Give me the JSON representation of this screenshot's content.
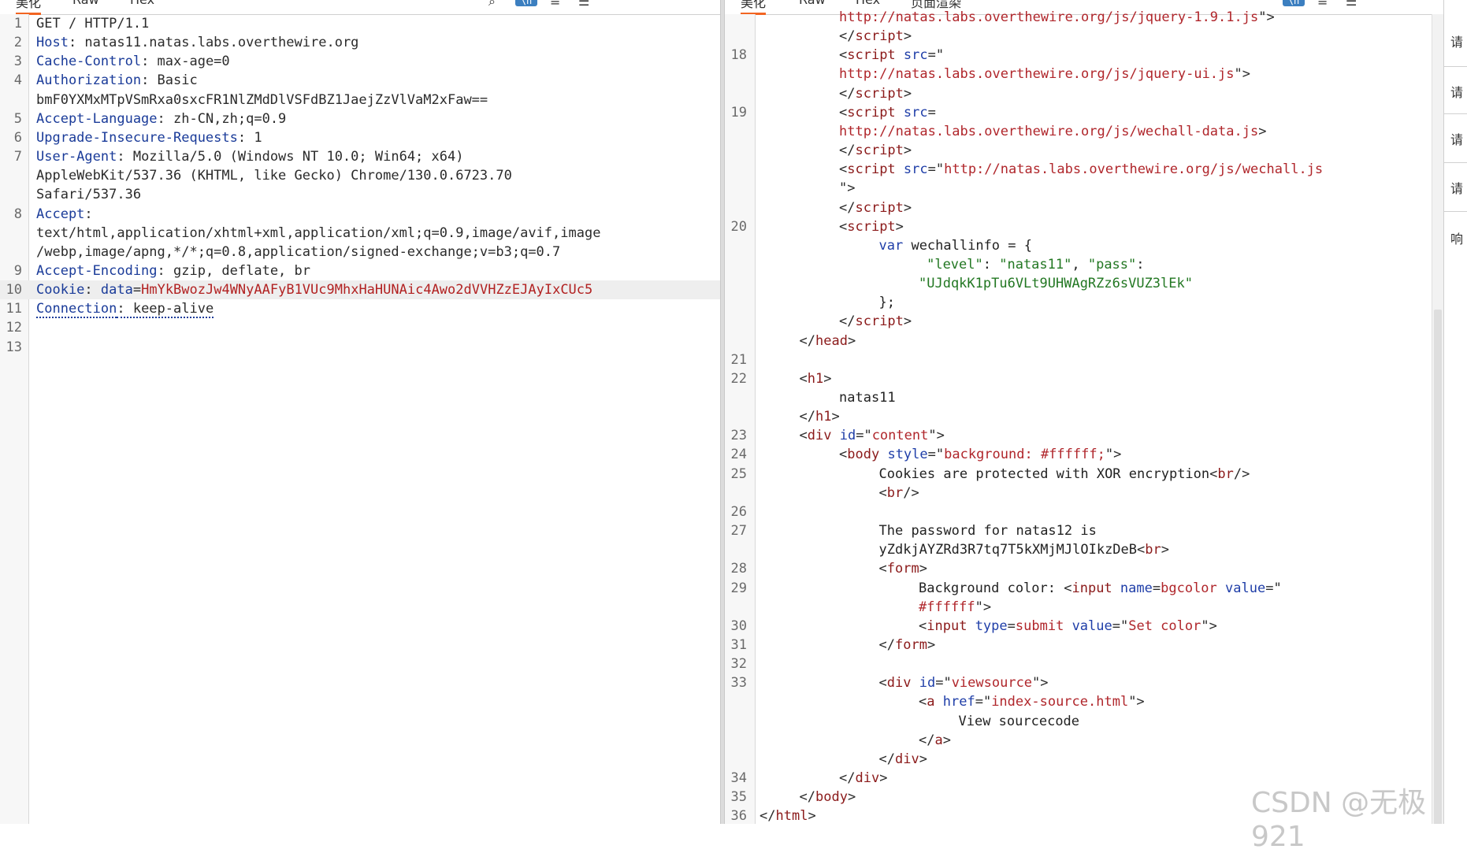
{
  "request_pane": {
    "tabs": [
      "美化",
      "Raw",
      "Hex"
    ],
    "icons": [
      "search-icon",
      "ln-toggle-icon",
      "wrap-icon",
      "menu-icon"
    ],
    "lines": [
      {
        "n": "1",
        "parts": [
          {
            "t": "GET / HTTP/1.1",
            "c": "v"
          }
        ]
      },
      {
        "n": "2",
        "parts": [
          {
            "t": "Host",
            "c": "k"
          },
          {
            "t": ": natas11.natas.labs.overthewire.org",
            "c": "v"
          }
        ]
      },
      {
        "n": "3",
        "parts": [
          {
            "t": "Cache-Control",
            "c": "k"
          },
          {
            "t": ": max-age=0",
            "c": "v"
          }
        ]
      },
      {
        "n": "4",
        "parts": [
          {
            "t": "Authorization",
            "c": "k"
          },
          {
            "t": ": Basic",
            "c": "v"
          }
        ]
      },
      {
        "n": "",
        "parts": [
          {
            "t": "bmF0YXMxMTpVSmRxa0sxcFR1NlZMdDlVSFdBZ1JaejZzVlVaM2xFaw==",
            "c": "v"
          }
        ]
      },
      {
        "n": "5",
        "parts": [
          {
            "t": "Accept-Language",
            "c": "k"
          },
          {
            "t": ": zh-CN,zh;q=0.9",
            "c": "v"
          }
        ]
      },
      {
        "n": "6",
        "parts": [
          {
            "t": "Upgrade-Insecure-Requests",
            "c": "k"
          },
          {
            "t": ": 1",
            "c": "v"
          }
        ]
      },
      {
        "n": "7",
        "parts": [
          {
            "t": "User-Agent",
            "c": "k"
          },
          {
            "t": ": Mozilla/5.0 (Windows NT 10.0; Win64; x64)",
            "c": "v"
          }
        ]
      },
      {
        "n": "",
        "parts": [
          {
            "t": "AppleWebKit/537.36 (KHTML, like Gecko) Chrome/130.0.6723.70",
            "c": "v"
          }
        ]
      },
      {
        "n": "",
        "parts": [
          {
            "t": "Safari/537.36",
            "c": "v"
          }
        ]
      },
      {
        "n": "8",
        "parts": [
          {
            "t": "Accept",
            "c": "k"
          },
          {
            "t": ":",
            "c": "v"
          }
        ]
      },
      {
        "n": "",
        "parts": [
          {
            "t": "text/html,application/xhtml+xml,application/xml;q=0.9,image/avif,image",
            "c": "v"
          }
        ]
      },
      {
        "n": "",
        "parts": [
          {
            "t": "/webp,image/apng,*/*;q=0.8,application/signed-exchange;v=b3;q=0.7",
            "c": "v"
          }
        ]
      },
      {
        "n": "9",
        "parts": [
          {
            "t": "Accept-Encoding",
            "c": "k"
          },
          {
            "t": ": gzip, deflate, br",
            "c": "v"
          }
        ]
      },
      {
        "n": "10",
        "hl": true,
        "parts": [
          {
            "t": "Cookie",
            "c": "k"
          },
          {
            "t": ": ",
            "c": "v"
          },
          {
            "t": "data",
            "c": "k"
          },
          {
            "t": "=",
            "c": "v"
          },
          {
            "t": "HmYkBwozJw4WNyAAFyB1VUc9MhxHaHUNAic4Awo2dVVHZzEJAyIxCUc5",
            "c": "red"
          }
        ]
      },
      {
        "n": "11",
        "parts": [
          {
            "t": "Connection",
            "c": "k dotted"
          },
          {
            "t": ": keep-alive",
            "c": "v dotted"
          }
        ]
      },
      {
        "n": "12",
        "parts": []
      },
      {
        "n": "13",
        "parts": []
      }
    ]
  },
  "response_pane": {
    "tabs": [
      "美化",
      "Raw",
      "Hex",
      "页面渲染"
    ],
    "icons": [
      "ln-toggle-icon",
      "wrap-icon",
      "menu-icon"
    ],
    "lines": [
      {
        "n": "",
        "indent": 10,
        "parts": [
          {
            "t": "http://natas.labs.overthewire.org/js/jquery-1.9.1.js",
            "c": "aval"
          },
          {
            "t": "\">",
            "c": "br"
          }
        ]
      },
      {
        "n": "",
        "indent": 10,
        "parts": [
          {
            "t": "</",
            "c": "br"
          },
          {
            "t": "script",
            "c": "tag"
          },
          {
            "t": ">",
            "c": "br"
          }
        ]
      },
      {
        "n": "18",
        "indent": 10,
        "parts": [
          {
            "t": "<",
            "c": "br"
          },
          {
            "t": "script",
            "c": "tag"
          },
          {
            "t": " ",
            "c": "br"
          },
          {
            "t": "src",
            "c": "attr"
          },
          {
            "t": "=\"",
            "c": "br"
          }
        ]
      },
      {
        "n": "",
        "indent": 10,
        "parts": [
          {
            "t": "http://natas.labs.overthewire.org/js/jquery-ui.js",
            "c": "aval"
          },
          {
            "t": "\">",
            "c": "br"
          }
        ]
      },
      {
        "n": "",
        "indent": 10,
        "parts": [
          {
            "t": "</",
            "c": "br"
          },
          {
            "t": "script",
            "c": "tag"
          },
          {
            "t": ">",
            "c": "br"
          }
        ]
      },
      {
        "n": "19",
        "indent": 10,
        "parts": [
          {
            "t": "<",
            "c": "br"
          },
          {
            "t": "script",
            "c": "tag"
          },
          {
            "t": " ",
            "c": "br"
          },
          {
            "t": "src",
            "c": "attr"
          },
          {
            "t": "=",
            "c": "br"
          }
        ]
      },
      {
        "n": "",
        "indent": 10,
        "parts": [
          {
            "t": "http://natas.labs.overthewire.org/js/wechall-data.js",
            "c": "aval"
          },
          {
            "t": ">",
            "c": "br"
          }
        ]
      },
      {
        "n": "",
        "indent": 10,
        "parts": [
          {
            "t": "</",
            "c": "br"
          },
          {
            "t": "script",
            "c": "tag"
          },
          {
            "t": ">",
            "c": "br"
          }
        ]
      },
      {
        "n": "",
        "indent": 10,
        "parts": [
          {
            "t": "<",
            "c": "br"
          },
          {
            "t": "script",
            "c": "tag"
          },
          {
            "t": " ",
            "c": "br"
          },
          {
            "t": "src",
            "c": "attr"
          },
          {
            "t": "=\"",
            "c": "br"
          },
          {
            "t": "http://natas.labs.overthewire.org/js/wechall.js",
            "c": "aval"
          }
        ]
      },
      {
        "n": "",
        "indent": 10,
        "parts": [
          {
            "t": "\">",
            "c": "br"
          }
        ]
      },
      {
        "n": "",
        "indent": 10,
        "parts": [
          {
            "t": "</",
            "c": "br"
          },
          {
            "t": "script",
            "c": "tag"
          },
          {
            "t": ">",
            "c": "br"
          }
        ]
      },
      {
        "n": "20",
        "indent": 10,
        "parts": [
          {
            "t": "<",
            "c": "br"
          },
          {
            "t": "script",
            "c": "tag"
          },
          {
            "t": ">",
            "c": "br"
          }
        ]
      },
      {
        "n": "",
        "indent": 15,
        "parts": [
          {
            "t": "var",
            "c": "jsk"
          },
          {
            "t": " wechallinfo = {",
            "c": "txt"
          }
        ]
      },
      {
        "n": "",
        "indent": 21,
        "parts": [
          {
            "t": "\"level\"",
            "c": "str"
          },
          {
            "t": ": ",
            "c": "txt"
          },
          {
            "t": "\"natas11\"",
            "c": "str"
          },
          {
            "t": ", ",
            "c": "txt"
          },
          {
            "t": "\"pass\"",
            "c": "str"
          },
          {
            "t": ":",
            "c": "txt"
          }
        ]
      },
      {
        "n": "",
        "indent": 20,
        "parts": [
          {
            "t": "\"UJdqkK1pTu6VLt9UHWAgRZz6sVUZ3lEk\"",
            "c": "str"
          }
        ]
      },
      {
        "n": "",
        "indent": 15,
        "parts": [
          {
            "t": "};",
            "c": "txt"
          }
        ]
      },
      {
        "n": "",
        "indent": 10,
        "parts": [
          {
            "t": "</",
            "c": "br"
          },
          {
            "t": "script",
            "c": "tag"
          },
          {
            "t": ">",
            "c": "br"
          }
        ]
      },
      {
        "n": "",
        "indent": 5,
        "parts": [
          {
            "t": "</",
            "c": "br"
          },
          {
            "t": "head",
            "c": "tag"
          },
          {
            "t": ">",
            "c": "br"
          }
        ]
      },
      {
        "n": "21",
        "indent": 0,
        "parts": []
      },
      {
        "n": "22",
        "indent": 5,
        "parts": [
          {
            "t": "<",
            "c": "br"
          },
          {
            "t": "h1",
            "c": "tag"
          },
          {
            "t": ">",
            "c": "br"
          }
        ]
      },
      {
        "n": "",
        "indent": 10,
        "parts": [
          {
            "t": "natas11",
            "c": "txt"
          }
        ]
      },
      {
        "n": "",
        "indent": 5,
        "parts": [
          {
            "t": "</",
            "c": "br"
          },
          {
            "t": "h1",
            "c": "tag"
          },
          {
            "t": ">",
            "c": "br"
          }
        ]
      },
      {
        "n": "23",
        "indent": 5,
        "parts": [
          {
            "t": "<",
            "c": "br"
          },
          {
            "t": "div",
            "c": "tag"
          },
          {
            "t": " ",
            "c": "br"
          },
          {
            "t": "id",
            "c": "attr"
          },
          {
            "t": "=\"",
            "c": "br"
          },
          {
            "t": "content",
            "c": "aval"
          },
          {
            "t": "\">",
            "c": "br"
          }
        ]
      },
      {
        "n": "24",
        "indent": 10,
        "parts": [
          {
            "t": "<",
            "c": "br"
          },
          {
            "t": "body",
            "c": "tag"
          },
          {
            "t": " ",
            "c": "br"
          },
          {
            "t": "style",
            "c": "attr"
          },
          {
            "t": "=\"",
            "c": "br"
          },
          {
            "t": "background: #ffffff;",
            "c": "aval"
          },
          {
            "t": "\">",
            "c": "br"
          }
        ]
      },
      {
        "n": "25",
        "indent": 15,
        "parts": [
          {
            "t": "Cookies are protected with XOR encryption",
            "c": "txt"
          },
          {
            "t": "<",
            "c": "br"
          },
          {
            "t": "br",
            "c": "tag"
          },
          {
            "t": "/>",
            "c": "br"
          }
        ]
      },
      {
        "n": "",
        "indent": 15,
        "parts": [
          {
            "t": "<",
            "c": "br"
          },
          {
            "t": "br",
            "c": "tag"
          },
          {
            "t": "/>",
            "c": "br"
          }
        ]
      },
      {
        "n": "26",
        "indent": 0,
        "parts": []
      },
      {
        "n": "27",
        "indent": 15,
        "parts": [
          {
            "t": "The password for natas12 is",
            "c": "txt"
          }
        ]
      },
      {
        "n": "",
        "indent": 15,
        "parts": [
          {
            "t": "yZdkjAYZRd3R7tq7T5kXMjMJlOIkzDeB",
            "c": "txt"
          },
          {
            "t": "<",
            "c": "br"
          },
          {
            "t": "br",
            "c": "tag"
          },
          {
            "t": ">",
            "c": "br"
          }
        ]
      },
      {
        "n": "28",
        "indent": 15,
        "parts": [
          {
            "t": "<",
            "c": "br"
          },
          {
            "t": "form",
            "c": "tag"
          },
          {
            "t": ">",
            "c": "br"
          }
        ]
      },
      {
        "n": "29",
        "indent": 20,
        "parts": [
          {
            "t": "Background color: ",
            "c": "txt"
          },
          {
            "t": "<",
            "c": "br"
          },
          {
            "t": "input",
            "c": "tag"
          },
          {
            "t": " ",
            "c": "br"
          },
          {
            "t": "name",
            "c": "attr"
          },
          {
            "t": "=",
            "c": "br"
          },
          {
            "t": "bgcolor",
            "c": "aval"
          },
          {
            "t": " ",
            "c": "br"
          },
          {
            "t": "value",
            "c": "attr"
          },
          {
            "t": "=\"",
            "c": "br"
          }
        ]
      },
      {
        "n": "",
        "indent": 20,
        "parts": [
          {
            "t": "#ffffff",
            "c": "aval"
          },
          {
            "t": "\">",
            "c": "br"
          }
        ]
      },
      {
        "n": "30",
        "indent": 20,
        "parts": [
          {
            "t": "<",
            "c": "br"
          },
          {
            "t": "input",
            "c": "tag"
          },
          {
            "t": " ",
            "c": "br"
          },
          {
            "t": "type",
            "c": "attr"
          },
          {
            "t": "=",
            "c": "br"
          },
          {
            "t": "submit",
            "c": "aval"
          },
          {
            "t": " ",
            "c": "br"
          },
          {
            "t": "value",
            "c": "attr"
          },
          {
            "t": "=\"",
            "c": "br"
          },
          {
            "t": "Set color",
            "c": "aval"
          },
          {
            "t": "\">",
            "c": "br"
          }
        ]
      },
      {
        "n": "31",
        "indent": 15,
        "parts": [
          {
            "t": "</",
            "c": "br"
          },
          {
            "t": "form",
            "c": "tag"
          },
          {
            "t": ">",
            "c": "br"
          }
        ]
      },
      {
        "n": "32",
        "indent": 0,
        "parts": []
      },
      {
        "n": "33",
        "indent": 15,
        "parts": [
          {
            "t": "<",
            "c": "br"
          },
          {
            "t": "div",
            "c": "tag"
          },
          {
            "t": " ",
            "c": "br"
          },
          {
            "t": "id",
            "c": "attr"
          },
          {
            "t": "=\"",
            "c": "br"
          },
          {
            "t": "viewsource",
            "c": "aval"
          },
          {
            "t": "\">",
            "c": "br"
          }
        ]
      },
      {
        "n": "",
        "indent": 20,
        "parts": [
          {
            "t": "<",
            "c": "br"
          },
          {
            "t": "a",
            "c": "tag"
          },
          {
            "t": " ",
            "c": "br"
          },
          {
            "t": "href",
            "c": "attr"
          },
          {
            "t": "=\"",
            "c": "br"
          },
          {
            "t": "index-source.html",
            "c": "aval"
          },
          {
            "t": "\">",
            "c": "br"
          }
        ]
      },
      {
        "n": "",
        "indent": 25,
        "parts": [
          {
            "t": "View sourcecode",
            "c": "txt"
          }
        ]
      },
      {
        "n": "",
        "indent": 20,
        "parts": [
          {
            "t": "</",
            "c": "br"
          },
          {
            "t": "a",
            "c": "tag"
          },
          {
            "t": ">",
            "c": "br"
          }
        ]
      },
      {
        "n": "",
        "indent": 15,
        "parts": [
          {
            "t": "</",
            "c": "br"
          },
          {
            "t": "div",
            "c": "tag"
          },
          {
            "t": ">",
            "c": "br"
          }
        ]
      },
      {
        "n": "34",
        "indent": 10,
        "parts": [
          {
            "t": "</",
            "c": "br"
          },
          {
            "t": "div",
            "c": "tag"
          },
          {
            "t": ">",
            "c": "br"
          }
        ]
      },
      {
        "n": "35",
        "indent": 5,
        "parts": [
          {
            "t": "</",
            "c": "br"
          },
          {
            "t": "body",
            "c": "tag"
          },
          {
            "t": ">",
            "c": "br"
          }
        ]
      },
      {
        "n": "36",
        "indent": 0,
        "parts": [
          {
            "t": "</",
            "c": "br"
          },
          {
            "t": "html",
            "c": "tag"
          },
          {
            "t": ">",
            "c": "br"
          }
        ]
      }
    ]
  },
  "side_panel": {
    "items": [
      "请",
      "请",
      "请",
      "请",
      "响"
    ]
  },
  "watermark": "CSDN @无极921",
  "colors": {
    "accent": "#f26522",
    "header_name": "#1a3b99",
    "cookie_value": "#b22222",
    "tag": "#8b1a1a",
    "attr": "#1f3ea8",
    "attr_value": "#b0262b",
    "string": "#227722"
  }
}
